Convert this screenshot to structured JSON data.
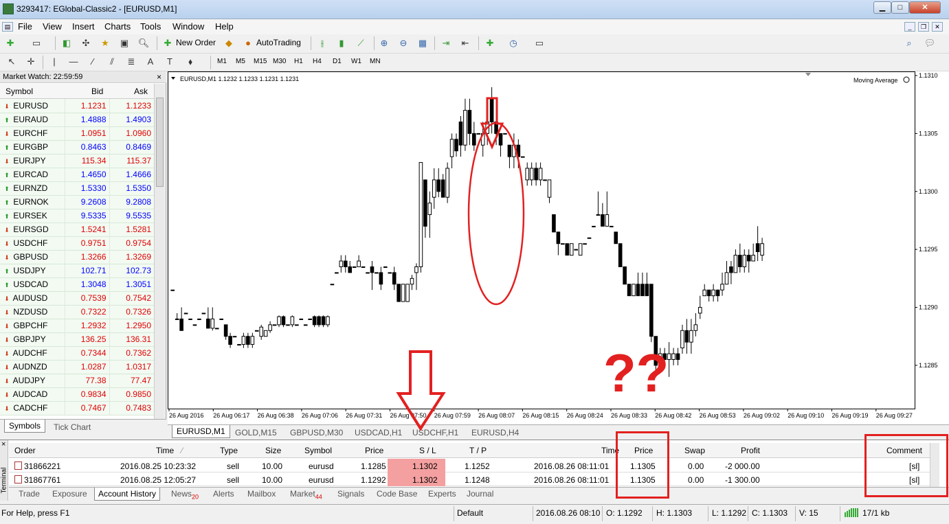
{
  "window": {
    "title": "3293417: EGlobal-Classic2 - [EURUSD,M1]"
  },
  "menu": [
    "File",
    "View",
    "Insert",
    "Charts",
    "Tools",
    "Window",
    "Help"
  ],
  "toolbar": {
    "new_order": "New Order",
    "autotrading": "AutoTrading"
  },
  "timeframes": [
    "M1",
    "M5",
    "M15",
    "M30",
    "H1",
    "H4",
    "D1",
    "W1",
    "MN"
  ],
  "market_watch": {
    "title": "Market Watch: 22:59:59",
    "col_symbol": "Symbol",
    "col_bid": "Bid",
    "col_ask": "Ask",
    "rows": [
      {
        "symbol": "EURUSD",
        "bid": "1.1231",
        "ask": "1.1233",
        "dir": "down"
      },
      {
        "symbol": "EURAUD",
        "bid": "1.4888",
        "ask": "1.4903",
        "dir": "up"
      },
      {
        "symbol": "EURCHF",
        "bid": "1.0951",
        "ask": "1.0960",
        "dir": "down"
      },
      {
        "symbol": "EURGBP",
        "bid": "0.8463",
        "ask": "0.8469",
        "dir": "up"
      },
      {
        "symbol": "EURJPY",
        "bid": "115.34",
        "ask": "115.37",
        "dir": "down"
      },
      {
        "symbol": "EURCAD",
        "bid": "1.4650",
        "ask": "1.4666",
        "dir": "up"
      },
      {
        "symbol": "EURNZD",
        "bid": "1.5330",
        "ask": "1.5350",
        "dir": "up"
      },
      {
        "symbol": "EURNOK",
        "bid": "9.2608",
        "ask": "9.2808",
        "dir": "up"
      },
      {
        "symbol": "EURSEK",
        "bid": "9.5335",
        "ask": "9.5535",
        "dir": "up"
      },
      {
        "symbol": "EURSGD",
        "bid": "1.5241",
        "ask": "1.5281",
        "dir": "down"
      },
      {
        "symbol": "USDCHF",
        "bid": "0.9751",
        "ask": "0.9754",
        "dir": "down"
      },
      {
        "symbol": "GBPUSD",
        "bid": "1.3266",
        "ask": "1.3269",
        "dir": "down"
      },
      {
        "symbol": "USDJPY",
        "bid": "102.71",
        "ask": "102.73",
        "dir": "up"
      },
      {
        "symbol": "USDCAD",
        "bid": "1.3048",
        "ask": "1.3051",
        "dir": "up"
      },
      {
        "symbol": "AUDUSD",
        "bid": "0.7539",
        "ask": "0.7542",
        "dir": "down"
      },
      {
        "symbol": "NZDUSD",
        "bid": "0.7322",
        "ask": "0.7326",
        "dir": "down"
      },
      {
        "symbol": "GBPCHF",
        "bid": "1.2932",
        "ask": "1.2950",
        "dir": "down"
      },
      {
        "symbol": "GBPJPY",
        "bid": "136.25",
        "ask": "136.31",
        "dir": "down"
      },
      {
        "symbol": "AUDCHF",
        "bid": "0.7344",
        "ask": "0.7362",
        "dir": "down"
      },
      {
        "symbol": "AUDNZD",
        "bid": "1.0287",
        "ask": "1.0317",
        "dir": "down"
      },
      {
        "symbol": "AUDJPY",
        "bid": "77.38",
        "ask": "77.47",
        "dir": "down"
      },
      {
        "symbol": "AUDCAD",
        "bid": "0.9834",
        "ask": "0.9850",
        "dir": "down"
      },
      {
        "symbol": "CADCHF",
        "bid": "0.7467",
        "ask": "0.7483",
        "dir": "down"
      }
    ],
    "tab_symbols": "Symbols",
    "tab_tick": "Tick Chart"
  },
  "chart": {
    "header": "EURUSD,M1  1.1232 1.1233 1.1231 1.1231",
    "indicator": "Moving Average",
    "tabs": [
      "EURUSD,M1",
      "GOLD,M15",
      "GBPUSD,M30",
      "USDCAD,H1",
      "USDCHF,H1",
      "EURUSD,H4"
    ]
  },
  "chart_data": {
    "type": "candlestick",
    "symbol": "EURUSD",
    "timeframe": "M1",
    "ylim": [
      1.12815,
      1.131
    ],
    "y_ticks": [
      "1.1310",
      "1.1305",
      "1.1300",
      "1.1295",
      "1.1290",
      "1.1285"
    ],
    "x_ticks": [
      "26 Aug 2016",
      "26 Aug 06:17",
      "26 Aug 06:38",
      "26 Aug 07:06",
      "26 Aug 07:31",
      "26 Aug 07:50",
      "26 Aug 07:59",
      "26 Aug 08:07",
      "26 Aug 08:15",
      "26 Aug 08:24",
      "26 Aug 08:33",
      "26 Aug 08:42",
      "26 Aug 08:53",
      "26 Aug 09:02",
      "26 Aug 09:10",
      "26 Aug 09:19",
      "26 Aug 09:27"
    ],
    "candles": [
      [
        1.12915,
        1.12915,
        1.12915,
        1.12915
      ],
      [
        1.1289,
        1.1289,
        1.12895,
        1.1289
      ],
      [
        1.1289,
        1.1288,
        1.129,
        1.12882
      ],
      [
        1.12895,
        1.12895,
        1.12895,
        1.12895
      ],
      [
        1.1289,
        1.1289,
        1.1289,
        1.1289
      ],
      [
        1.12885,
        1.12885,
        1.12885,
        1.12885
      ],
      [
        1.1289,
        1.1289,
        1.1289,
        1.1289
      ],
      [
        1.12895,
        1.12895,
        1.12895,
        1.12895
      ],
      [
        1.1289,
        1.12882,
        1.129,
        1.12882
      ],
      [
        1.12882,
        1.1289,
        1.129,
        1.1288
      ],
      [
        1.12882,
        1.12882,
        1.12882,
        1.12882
      ],
      [
        1.1289,
        1.1289,
        1.1289,
        1.1289
      ],
      [
        1.12885,
        1.12875,
        1.12885,
        1.12872
      ],
      [
        1.12875,
        1.12868,
        1.12878,
        1.12865
      ],
      [
        1.12875,
        1.12875,
        1.12875,
        1.12875
      ],
      [
        1.12868,
        1.12868,
        1.12868,
        1.12868
      ],
      [
        1.12868,
        1.12875,
        1.12878,
        1.12865
      ],
      [
        1.12875,
        1.12868,
        1.12878,
        1.12865
      ],
      [
        1.12868,
        1.12875,
        1.12878,
        1.12865
      ],
      [
        1.1288,
        1.1288,
        1.1288,
        1.1288
      ],
      [
        1.12875,
        1.12883,
        1.12885,
        1.12872
      ],
      [
        1.12875,
        1.1288,
        1.1288,
        1.12875
      ],
      [
        1.1288,
        1.12885,
        1.12888,
        1.12878
      ],
      [
        1.12885,
        1.12885,
        1.12885,
        1.12885
      ],
      [
        1.12885,
        1.12892,
        1.12893,
        1.12883
      ],
      [
        1.12892,
        1.12885,
        1.12893,
        1.12883
      ],
      [
        1.12885,
        1.12885,
        1.12885,
        1.12885
      ],
      [
        1.12885,
        1.12892,
        1.12893,
        1.12883
      ],
      [
        1.12885,
        1.12885,
        1.12885,
        1.12885
      ],
      [
        1.1289,
        1.1289,
        1.1289,
        1.1289
      ],
      [
        1.12885,
        1.12885,
        1.12885,
        1.12885
      ],
      [
        1.1289,
        1.1289,
        1.1289,
        1.1289
      ],
      [
        1.12892,
        1.12885,
        1.12893,
        1.12883
      ],
      [
        1.12892,
        1.12885,
        1.12893,
        1.12883
      ],
      [
        1.12892,
        1.12885,
        1.12893,
        1.12883
      ],
      [
        1.12885,
        1.12892,
        1.12893,
        1.12883
      ],
      [
        1.1292,
        1.1292,
        1.1292,
        1.1292
      ],
      [
        1.1293,
        1.1293,
        1.1293,
        1.1293
      ],
      [
        1.12935,
        1.1294,
        1.12945,
        1.1293
      ],
      [
        1.1294,
        1.12935,
        1.12945,
        1.1293
      ],
      [
        1.12935,
        1.1293,
        1.1294,
        1.1293
      ],
      [
        1.12935,
        1.12935,
        1.12935,
        1.12935
      ],
      [
        1.12935,
        1.1294,
        1.12945,
        1.12935
      ],
      [
        1.12935,
        1.12935,
        1.12935,
        1.12935
      ],
      [
        1.1293,
        1.1293,
        1.1293,
        1.1293
      ],
      [
        1.12935,
        1.1293,
        1.1294,
        1.12915
      ],
      [
        1.1293,
        1.1293,
        1.1293,
        1.1293
      ],
      [
        1.1293,
        1.1292,
        1.12935,
        1.12915
      ],
      [
        1.12935,
        1.12935,
        1.12935,
        1.12935
      ],
      [
        1.1293,
        1.1293,
        1.1293,
        1.1293
      ],
      [
        1.1293,
        1.1292,
        1.12935,
        1.12915
      ],
      [
        1.1292,
        1.12905,
        1.1292,
        1.12905
      ],
      [
        1.12905,
        1.1292,
        1.1292,
        1.12905
      ],
      [
        1.12905,
        1.1292,
        1.1292,
        1.12905
      ],
      [
        1.1292,
        1.12925,
        1.12928,
        1.12915
      ],
      [
        1.1293,
        1.12935,
        1.12938,
        1.12915
      ],
      [
        1.12935,
        1.13025,
        1.13025,
        1.1293
      ],
      [
        1.1301,
        1.1297,
        1.1301,
        1.1296
      ],
      [
        1.1298,
        1.1299,
        1.13,
        1.1296
      ],
      [
        1.12995,
        1.1301,
        1.1302,
        1.12985
      ],
      [
        1.1301,
        1.13,
        1.1302,
        1.12995
      ],
      [
        1.1301,
        1.12995,
        1.13015,
        1.12995
      ],
      [
        1.12995,
        1.1302,
        1.13025,
        1.1299
      ],
      [
        1.1303,
        1.13045,
        1.1305,
        1.1302
      ],
      [
        1.13045,
        1.13035,
        1.1305,
        1.1303
      ],
      [
        1.1306,
        1.1304,
        1.13065,
        1.1303
      ],
      [
        1.1304,
        1.1307,
        1.1308,
        1.13035
      ],
      [
        1.1307,
        1.1305,
        1.1308,
        1.1304
      ],
      [
        1.1305,
        1.1304,
        1.1306,
        1.13035
      ],
      [
        1.1305,
        1.1305,
        1.1305,
        1.1305
      ],
      [
        1.1304,
        1.1305,
        1.1306,
        1.1303
      ],
      [
        1.1305,
        1.1306,
        1.1307,
        1.1304
      ],
      [
        1.1308,
        1.1306,
        1.1309,
        1.1305
      ],
      [
        1.1306,
        1.1305,
        1.13065,
        1.1304
      ],
      [
        1.1305,
        1.1304,
        1.1305,
        1.1303
      ],
      [
        1.1305,
        1.1305,
        1.1305,
        1.1305
      ],
      [
        1.1304,
        1.1303,
        1.1304,
        1.1302
      ],
      [
        1.1303,
        1.1304,
        1.1305,
        1.1302
      ],
      [
        1.1304,
        1.1303,
        1.13045,
        1.1302
      ],
      [
        1.1303,
        1.1303,
        1.1303,
        1.1303
      ],
      [
        1.1301,
        1.1302,
        1.13025,
        1.13005
      ],
      [
        1.1301,
        1.1302,
        1.13025,
        1.13005
      ],
      [
        1.1302,
        1.1301,
        1.13025,
        1.13005
      ],
      [
        1.1301,
        1.1302,
        1.13025,
        1.13005
      ],
      [
        1.1301,
        1.1301,
        1.1301,
        1.1301
      ],
      [
        1.12995,
        1.1301,
        1.1301,
        1.1299
      ],
      [
        1.1298,
        1.12965,
        1.1298,
        1.12965
      ],
      [
        1.12965,
        1.12955,
        1.12965,
        1.12945
      ],
      [
        1.12955,
        1.12955,
        1.12955,
        1.12955
      ],
      [
        1.12955,
        1.12945,
        1.12955,
        1.12945
      ],
      [
        1.12945,
        1.12955,
        1.12955,
        1.12945
      ],
      [
        1.1295,
        1.1295,
        1.1295,
        1.1295
      ],
      [
        1.12945,
        1.12955,
        1.12955,
        1.12945
      ],
      [
        1.12955,
        1.12955,
        1.12955,
        1.12955
      ],
      [
        1.1296,
        1.1296,
        1.1296,
        1.1296
      ],
      [
        1.1297,
        1.1297,
        1.1297,
        1.1297
      ],
      [
        1.1298,
        1.1298,
        1.13,
        1.1298
      ],
      [
        1.1298,
        1.1297,
        1.1299,
        1.1297
      ],
      [
        1.1297,
        1.1298,
        1.13,
        1.1297
      ],
      [
        1.1297,
        1.1297,
        1.1297,
        1.1297
      ],
      [
        1.12965,
        1.12955,
        1.12965,
        1.12955
      ],
      [
        1.12955,
        1.12935,
        1.12955,
        1.12935
      ],
      [
        1.12935,
        1.1292,
        1.12935,
        1.1292
      ],
      [
        1.1292,
        1.1291,
        1.1292,
        1.1291
      ],
      [
        1.1291,
        1.1292,
        1.1292,
        1.1291
      ],
      [
        1.1292,
        1.1291,
        1.1293,
        1.1291
      ],
      [
        1.1292,
        1.1291,
        1.1293,
        1.1291
      ],
      [
        1.1292,
        1.1291,
        1.1293,
        1.1291
      ],
      [
        1.1292,
        1.12875,
        1.1292,
        1.1287
      ],
      [
        1.12875,
        1.1285,
        1.12875,
        1.1284
      ],
      [
        1.12855,
        1.1286,
        1.12865,
        1.1285
      ],
      [
        1.1286,
        1.12855,
        1.12865,
        1.1285
      ],
      [
        1.12855,
        1.1286,
        1.1287,
        1.1284
      ],
      [
        1.12855,
        1.1286,
        1.12865,
        1.1285
      ],
      [
        1.1286,
        1.12855,
        1.12865,
        1.1285
      ],
      [
        1.12865,
        1.1288,
        1.12885,
        1.1286
      ],
      [
        1.1288,
        1.1287,
        1.1289,
        1.1286
      ],
      [
        1.1287,
        1.1288,
        1.1289,
        1.1286
      ],
      [
        1.1288,
        1.12885,
        1.12895,
        1.12875
      ],
      [
        1.12895,
        1.129,
        1.1291,
        1.1289
      ],
      [
        1.1291,
        1.12915,
        1.1292,
        1.1291
      ],
      [
        1.12915,
        1.1291,
        1.12915,
        1.12905
      ],
      [
        1.1291,
        1.12915,
        1.1292,
        1.12905
      ],
      [
        1.12915,
        1.1291,
        1.12915,
        1.12905
      ],
      [
        1.12915,
        1.1292,
        1.1293,
        1.1291
      ],
      [
        1.1292,
        1.1293,
        1.1294,
        1.1292
      ],
      [
        1.12935,
        1.1293,
        1.1294,
        1.1292
      ],
      [
        1.1293,
        1.12945,
        1.1295,
        1.1293
      ],
      [
        1.12945,
        1.12935,
        1.12955,
        1.1293
      ],
      [
        1.12935,
        1.12945,
        1.1295,
        1.1293
      ],
      [
        1.12945,
        1.1294,
        1.1295,
        1.1293
      ],
      [
        1.1294,
        1.12945,
        1.12955,
        1.1294
      ],
      [
        1.12955,
        1.12948,
        1.1297,
        1.1294
      ],
      [
        1.12945,
        1.12955,
        1.1296,
        1.1294
      ]
    ]
  },
  "terminal": {
    "side_label": "Terminal",
    "close": "×",
    "columns": {
      "order": "Order",
      "time": "Time",
      "type": "Type",
      "size": "Size",
      "symbol": "Symbol",
      "price": "Price",
      "sl": "S / L",
      "tp": "T / P",
      "close_time": "Time",
      "close_price": "Price",
      "swap": "Swap",
      "profit": "Profit",
      "comment": "Comment"
    },
    "rows": [
      {
        "order": "31866221",
        "time": "2016.08.25 10:23:32",
        "type": "sell",
        "size": "10.00",
        "symbol": "eurusd",
        "price": "1.1285",
        "sl": "1.1302",
        "tp": "1.1252",
        "close_time": "2016.08.26 08:11:01",
        "close_price": "1.1305",
        "swap": "0.00",
        "profit": "-2 000.00",
        "comment": "[sl]"
      },
      {
        "order": "31867761",
        "time": "2016.08.25 12:05:27",
        "type": "sell",
        "size": "10.00",
        "symbol": "eurusd",
        "price": "1.1292",
        "sl": "1.1302",
        "tp": "1.1248",
        "close_time": "2016.08.26 08:11:01",
        "close_price": "1.1305",
        "swap": "0.00",
        "profit": "-1 300.00",
        "comment": "[sl]"
      }
    ],
    "tabs": [
      {
        "label": "Trade"
      },
      {
        "label": "Exposure"
      },
      {
        "label": "Account History",
        "active": true
      },
      {
        "label": "News",
        "badge": "20"
      },
      {
        "label": "Alerts"
      },
      {
        "label": "Mailbox"
      },
      {
        "label": "Market",
        "badge": "44"
      },
      {
        "label": "Signals"
      },
      {
        "label": "Code Base"
      },
      {
        "label": "Experts"
      },
      {
        "label": "Journal"
      }
    ]
  },
  "status": {
    "help": "For Help, press F1",
    "profile": "Default",
    "datetime": "2016.08.26 08:10",
    "open": "O: 1.1292",
    "high": "H: 1.1303",
    "low": "L: 1.1292",
    "close": "C: 1.1303",
    "volume": "V: 15",
    "traffic": "17/1 kb"
  },
  "annotation": {
    "question": "??"
  },
  "colors": {
    "up": "#0000ff",
    "down": "#e00000",
    "sl_highlight": "#f4a0a0",
    "annotation": "#e32020"
  }
}
